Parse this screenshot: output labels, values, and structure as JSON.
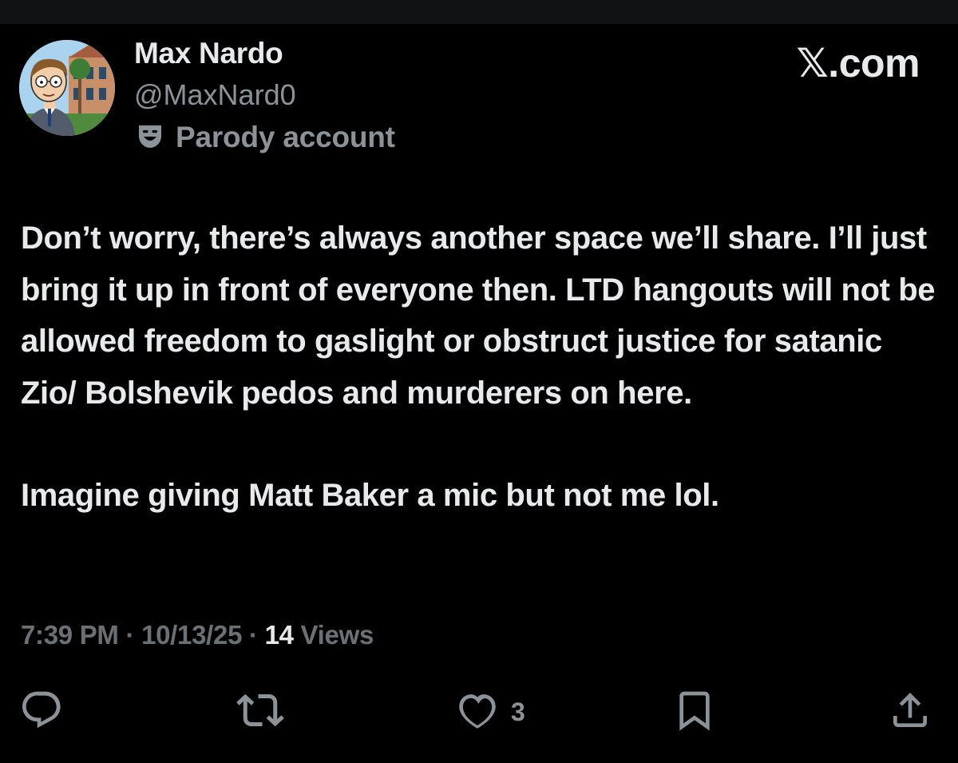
{
  "author": {
    "name": "Max Nardo",
    "handle": "@MaxNard0",
    "label": "Parody account",
    "label_icon": "theater-mask-icon",
    "avatar": "avatar"
  },
  "brand": {
    "x": "𝕏",
    "suffix": ".com"
  },
  "post": {
    "paragraphs": [
      "Don’t worry, there’s always another space we’ll share. I’ll just bring it up in front of everyone then. LTD hangouts will not be allowed freedom to gaslight or obstruct justice for satanic Zio/ Bolshevik pedos and murderers on here.",
      "Imagine giving Matt Baker a mic but not me lol."
    ]
  },
  "meta": {
    "time": "7:39 PM",
    "sep1": " · ",
    "date": "10/13/25",
    "sep2": " · ",
    "views_count": "14",
    "views_label": " Views"
  },
  "actions": {
    "reply_icon": "reply-icon",
    "repost_icon": "repost-icon",
    "like_icon": "heart-icon",
    "like_count": "3",
    "bookmark_icon": "bookmark-icon",
    "share_icon": "share-icon"
  },
  "colors": {
    "background": "#000000",
    "primary_text": "#e7e9ea",
    "secondary_text": "#8b9399",
    "meta_text": "#6b7075"
  }
}
